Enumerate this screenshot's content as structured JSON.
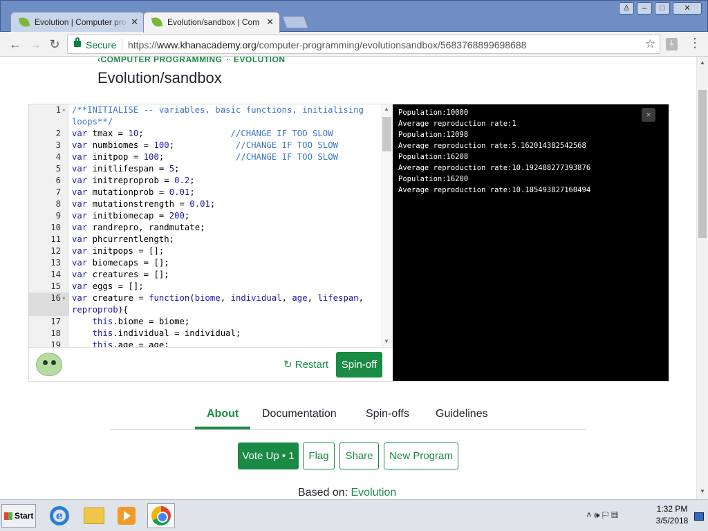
{
  "browser": {
    "tabs": [
      {
        "title": "Evolution | Computer pro",
        "active": false
      },
      {
        "title": "Evolution/sandbox | Com",
        "active": true
      }
    ],
    "security_label": "Secure",
    "url_scheme": "https://",
    "url_host": "www.khanacademy.org",
    "url_path": "/computer-programming/evolutionsandbox/5683768899698688"
  },
  "page": {
    "breadcrumb": {
      "parent": "COMPUTER PROGRAMMING",
      "current": "EVOLUTION"
    },
    "title": "Evolution/sandbox"
  },
  "editor": {
    "lines": [
      {
        "n": "1",
        "fold": true,
        "html": "<span class=\"cmt\">/**INITIALISE -- variables, basic functions, initialising</span>"
      },
      {
        "n": "",
        "fold": false,
        "html": "<span class=\"cmt\">loops**/</span>"
      },
      {
        "n": "2",
        "fold": false,
        "html": "<span class=\"kw\">var</span> tmax = <span class=\"num\">10</span>;                 <span class=\"cmt\">//CHANGE IF TOO SLOW</span>"
      },
      {
        "n": "3",
        "fold": false,
        "html": "<span class=\"kw\">var</span> numbiomes = <span class=\"num\">100</span>;            <span class=\"cmt\">//CHANGE IF TOO SLOW</span>"
      },
      {
        "n": "4",
        "fold": false,
        "html": "<span class=\"kw\">var</span> initpop = <span class=\"num\">100</span>;              <span class=\"cmt\">//CHANGE IF TOO SLOW</span>"
      },
      {
        "n": "5",
        "fold": false,
        "html": "<span class=\"kw\">var</span> initlifespan = <span class=\"num\">5</span>;"
      },
      {
        "n": "6",
        "fold": false,
        "html": "<span class=\"kw\">var</span> initreproprob = <span class=\"num\">0.2</span>;"
      },
      {
        "n": "7",
        "fold": false,
        "html": "<span class=\"kw\">var</span> mutationprob = <span class=\"num\">0.01</span>;"
      },
      {
        "n": "8",
        "fold": false,
        "html": "<span class=\"kw\">var</span> mutationstrength = <span class=\"num\">0.01</span>;"
      },
      {
        "n": "9",
        "fold": false,
        "html": "<span class=\"kw\">var</span> initbiomecap = <span class=\"num\">200</span>;"
      },
      {
        "n": "10",
        "fold": false,
        "html": "<span class=\"kw\">var</span> randrepro, randmutate;"
      },
      {
        "n": "11",
        "fold": false,
        "html": "<span class=\"kw\">var</span> phcurrentlength;"
      },
      {
        "n": "12",
        "fold": false,
        "html": "<span class=\"kw\">var</span> initpops = [];"
      },
      {
        "n": "13",
        "fold": false,
        "html": "<span class=\"kw\">var</span> biomecaps = [];"
      },
      {
        "n": "14",
        "fold": false,
        "html": "<span class=\"kw\">var</span> creatures = [];"
      },
      {
        "n": "15",
        "fold": false,
        "html": "<span class=\"kw\">var</span> eggs = [];"
      },
      {
        "n": "16",
        "fold": true,
        "html": "<span class=\"kw\">var</span> creature = <span class=\"kw\">function</span>(<span class=\"num\">biome</span>, <span class=\"num\">individual</span>, <span class=\"num\">age</span>, <span class=\"num\">lifespan</span>,"
      },
      {
        "n": "",
        "fold": false,
        "html": "<span class=\"num\">reproprob</span>){"
      },
      {
        "n": "17",
        "fold": false,
        "html": "    <span class=\"kw\">this</span>.biome = biome;"
      },
      {
        "n": "18",
        "fold": false,
        "html": "    <span class=\"kw\">this</span>.individual = individual;"
      },
      {
        "n": "19",
        "fold": false,
        "html": "    <span class=\"kw\">this</span>.age = age;"
      }
    ],
    "restart_label": "Restart",
    "spinoff_label": "Spin-off"
  },
  "console": {
    "lines": [
      "Population:10000",
      "Average reproduction rate:1",
      "Population:12098",
      "Average reproduction rate:5.162014382542568",
      "Population:16208",
      "Average reproduction rate:10.192488277393876",
      "Population:16200",
      "Average reproduction rate:10.185493827160494"
    ],
    "close_label": "×"
  },
  "program_tabs": [
    "About",
    "Documentation",
    "Spin-offs",
    "Guidelines"
  ],
  "actions": {
    "vote_up": "Vote Up • 1",
    "flag": "Flag",
    "share": "Share",
    "new_program": "New Program"
  },
  "based_on": {
    "prefix": "Based on: ",
    "link": "Evolution"
  },
  "taskbar": {
    "start_label": "Start",
    "time": "1:32 PM",
    "date": "3/5/2018"
  },
  "colors": {
    "brand_green": "#1a8b45",
    "titlebar_blue": "#6f8fc4",
    "console_bg": "#000000"
  }
}
